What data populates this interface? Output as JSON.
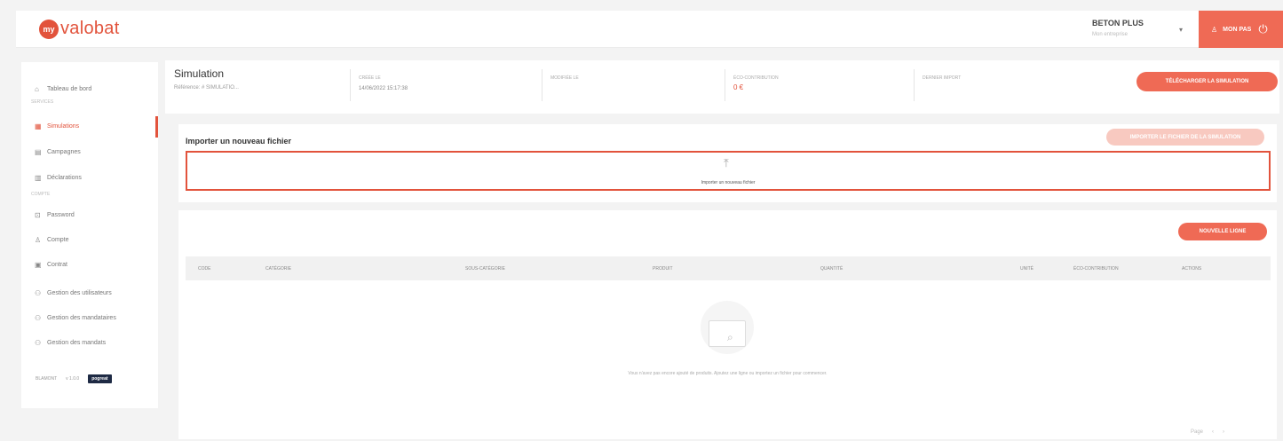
{
  "header": {
    "logo_mark": "my",
    "logo_text": "valobat",
    "org_name": "BETON PLUS",
    "org_sub": "Mon entreprise",
    "user_name": "MON PAS"
  },
  "sidebar": {
    "items": [
      {
        "label": "Tableau de bord",
        "icon": "home-icon"
      },
      {
        "label": "Simulations",
        "icon": "calculator-icon",
        "active": true
      },
      {
        "label": "Campagnes",
        "icon": "folder-icon"
      },
      {
        "label": "Déclarations",
        "icon": "document-icon"
      },
      {
        "label": "Password",
        "icon": "lock-icon"
      },
      {
        "label": "Compte",
        "icon": "user-icon"
      },
      {
        "label": "Contrat",
        "icon": "contract-icon"
      },
      {
        "label": "Gestion des utilisateurs",
        "icon": "users-icon"
      },
      {
        "label": "Gestion des mandataires",
        "icon": "users-icon"
      },
      {
        "label": "Gestion des mandats",
        "icon": "users-icon"
      }
    ],
    "section_services": "Services",
    "section_account": "Compte",
    "footer_links": [
      "BLAMONT",
      "v 1.0.0"
    ],
    "footer_badge": "pogreat"
  },
  "simulation": {
    "title": "Simulation",
    "reference": "Référence: # SIMULATIO...",
    "fields": [
      {
        "label": "Créée le",
        "value": "14/06/2022 15:17:38"
      },
      {
        "label": "Modifiée le",
        "value": ""
      },
      {
        "label": "Éco-contribution",
        "value": "0 €"
      },
      {
        "label": "Dernier import",
        "value": ""
      }
    ],
    "export_button": "TÉLÉCHARGER LA SIMULATION"
  },
  "import": {
    "title": "Importer un nouveau fichier",
    "secondary_button": "IMPORTER LE FICHIER DE LA SIMULATION",
    "dropzone_text": "Importer un nouveau fichier"
  },
  "table": {
    "new_line_button": "NOUVELLE LIGNE",
    "columns": [
      "Code",
      "Catégorie",
      "Sous-catégorie",
      "Produit",
      "Quantité",
      "Unité",
      "Éco-contribution",
      "Actions"
    ],
    "rows": [],
    "empty_text": "Vous n'avez pas encore ajouté de produits. Ajoutez une ligne ou importez un fichier pour commencer.",
    "pager_label": "Page"
  }
}
